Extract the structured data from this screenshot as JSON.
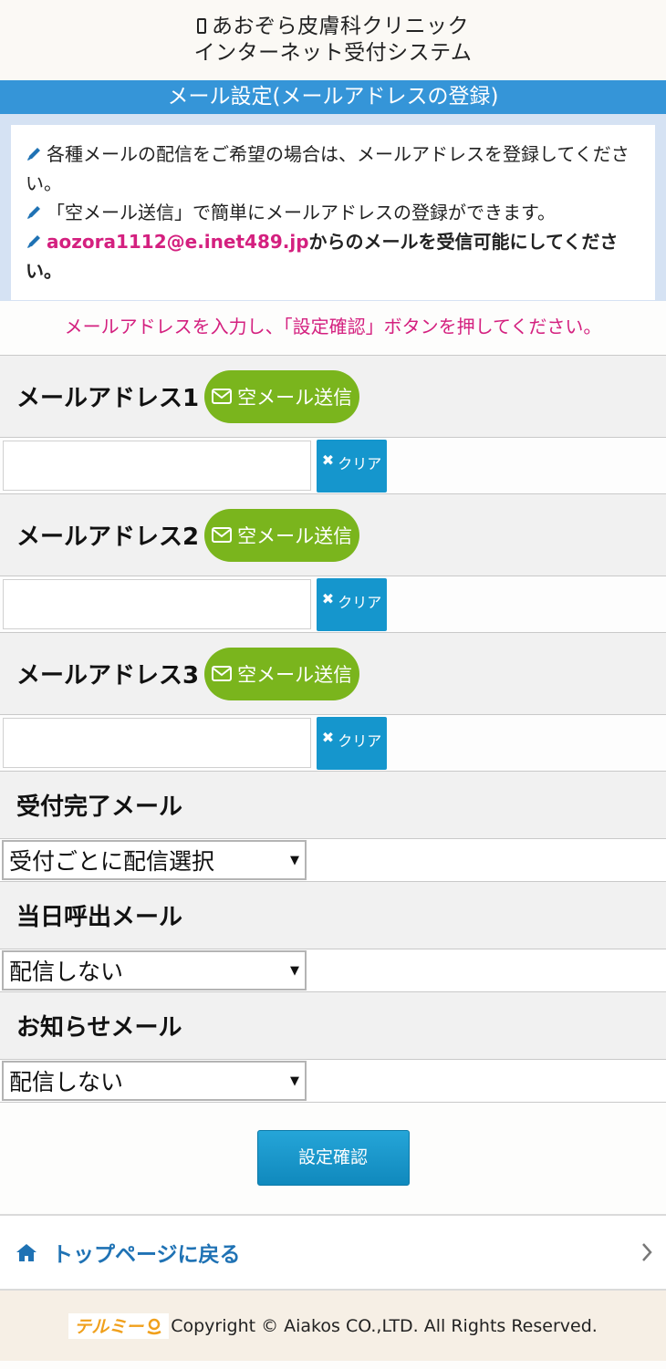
{
  "header": {
    "clinic_name": "あおぞら皮膚科クリニック",
    "system_name": "インターネット受付システム"
  },
  "title": "メール設定(メールアドレスの登録)",
  "notice": {
    "line1": "各種メールの配信をご希望の場合は、メールアドレスを登録してください。",
    "line2": "「空メール送信」で簡単にメールアドレスの登録ができます。",
    "line3_email": "aozora1112@e.inet489.jp",
    "line3_rest": "からのメールを受信可能にしてください。"
  },
  "instruction": "メールアドレスを入力し、「設定確認」ボタンを押してください。",
  "addresses": [
    {
      "label": "メールアドレス1",
      "button": "空メール送信",
      "value": "",
      "clear": "クリア"
    },
    {
      "label": "メールアドレス2",
      "button": "空メール送信",
      "value": "",
      "clear": "クリア"
    },
    {
      "label": "メールアドレス3",
      "button": "空メール送信",
      "value": "",
      "clear": "クリア"
    }
  ],
  "options": [
    {
      "label": "受付完了メール",
      "selected": "受付ごとに配信選択"
    },
    {
      "label": "当日呼出メール",
      "selected": "配信しない"
    },
    {
      "label": "お知らせメール",
      "selected": "配信しない"
    }
  ],
  "confirm_button": "設定確認",
  "back_link": "トップページに戻る",
  "footer": {
    "logo_text": "テルミー",
    "copyright": "Copyright © Aiakos CO.,LTD. All Rights Reserved."
  },
  "colors": {
    "title_bar": "#3595d8",
    "accent_pink": "#d4207f",
    "sky_button": "#7ab51d",
    "clear_button": "#1596cd"
  },
  "icons": {
    "header": "phone-icon",
    "notice": "pencil-icon",
    "sky_button": "mail-icon",
    "clear": "x-icon",
    "back": "home-icon",
    "chevron": "chevron-right-icon",
    "select": "dropdown-arrow-icon"
  }
}
